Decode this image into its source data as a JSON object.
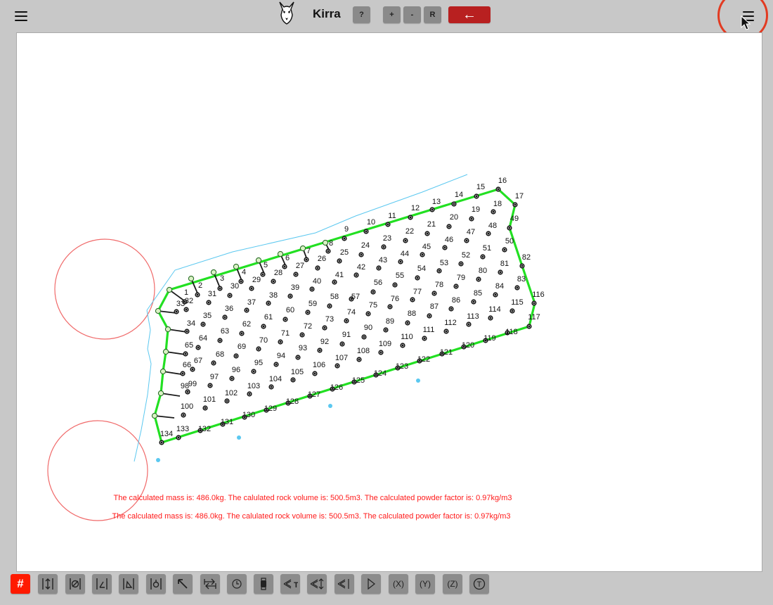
{
  "header": {
    "app_title": "Kirra",
    "logo_icon": "dog-head-logo",
    "help_label": "?",
    "zoom_in_label": "+",
    "zoom_out_label": "-",
    "reset_label": "R",
    "back_label": "←",
    "back_color": "#b82020"
  },
  "canvas": {
    "messages": [
      "The calculated mass is: 486.0kg. The calulated rock volume is: 500.5m3. The calculated powder factor is: 0.97kg/m3",
      "The calculated mass is: 486.0kg. The calulated rock volume is: 500.5m3. The calculated powder factor is: 0.97kg/m3"
    ],
    "message_color": "#ff1a1a",
    "boundary_color": "#22e022",
    "line_color": "#5bc8f0",
    "circle_color": "#f06a6a",
    "hole_ids": [
      "1",
      "2",
      "3",
      "4",
      "5",
      "6",
      "7",
      "8",
      "9",
      "10",
      "11",
      "12",
      "13",
      "14",
      "15",
      "16",
      "17",
      "18",
      "19",
      "20",
      "21",
      "22",
      "23",
      "24",
      "25",
      "26",
      "27",
      "28",
      "29",
      "30",
      "31",
      "32",
      "33",
      "34",
      "35",
      "36",
      "37",
      "38",
      "39",
      "40",
      "41",
      "42",
      "43",
      "44",
      "45",
      "46",
      "47",
      "48",
      "49",
      "50",
      "51",
      "52",
      "53",
      "54",
      "55",
      "56",
      "57",
      "58",
      "59",
      "60",
      "61",
      "62",
      "63",
      "64",
      "65",
      "66",
      "67",
      "68",
      "69",
      "70",
      "71",
      "72",
      "73",
      "74",
      "75",
      "76",
      "77",
      "78",
      "79",
      "80",
      "81",
      "82",
      "83",
      "84",
      "85",
      "86",
      "87",
      "88",
      "89",
      "90",
      "91",
      "92",
      "93",
      "94",
      "95",
      "96",
      "97",
      "98",
      "99",
      "100",
      "101",
      "102",
      "103",
      "104",
      "105",
      "106",
      "107",
      "108",
      "109",
      "110",
      "111",
      "112",
      "113",
      "114",
      "115",
      "116",
      "117",
      "118",
      "119",
      "120",
      "121",
      "122",
      "123",
      "124",
      "125",
      "126",
      "127",
      "128",
      "129",
      "130",
      "131",
      "132",
      "133",
      "134",
      "135"
    ]
  },
  "toolbar": {
    "active_color": "#ff1a00",
    "buttons": [
      {
        "icon": "grid-hash-icon",
        "label": "#"
      },
      {
        "icon": "vertical-measure-icon",
        "label": ""
      },
      {
        "icon": "diameter-icon",
        "label": ""
      },
      {
        "icon": "angle-icon",
        "label": ""
      },
      {
        "icon": "bearing-angle-icon",
        "label": ""
      },
      {
        "icon": "subdrill-icon",
        "label": ""
      },
      {
        "icon": "arrow-up-left-icon",
        "label": ""
      },
      {
        "icon": "swap-arrows-icon",
        "label": ""
      },
      {
        "icon": "clock-icon",
        "label": ""
      },
      {
        "icon": "watch-icon",
        "label": ""
      },
      {
        "icon": "tie-icon",
        "label": "T"
      },
      {
        "icon": "tie-length-icon",
        "label": ""
      },
      {
        "icon": "tie-end-icon",
        "label": ""
      },
      {
        "icon": "play-triangle-icon",
        "label": ""
      },
      {
        "icon": "x-coordinate-icon",
        "label": "(X)"
      },
      {
        "icon": "y-coordinate-icon",
        "label": "(Y)"
      },
      {
        "icon": "z-coordinate-icon",
        "label": "(Z)"
      },
      {
        "icon": "text-circle-icon",
        "label": "T"
      }
    ]
  }
}
